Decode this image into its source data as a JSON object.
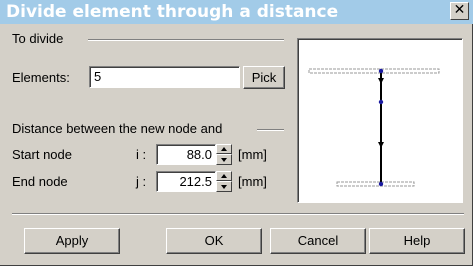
{
  "window": {
    "title": "Divide element through a distance",
    "close_glyph": "✕"
  },
  "divide_group": {
    "heading": "To divide",
    "elements_label": "Elements:",
    "elements_value": "5",
    "pick_label": "Pick"
  },
  "distance_group": {
    "heading": "Distance between the new node and",
    "start": {
      "label": "Start node",
      "index": "i :",
      "value": "88.0",
      "unit": "[mm]"
    },
    "end": {
      "label": "End node",
      "index": "j :",
      "value": "212.5",
      "unit": "[mm]"
    }
  },
  "buttons": {
    "apply": "Apply",
    "ok": "OK",
    "cancel": "Cancel",
    "help": "Help"
  },
  "colors": {
    "titlebar": "#a2cbe8",
    "dialog_bg": "#d4d0c8",
    "node_blue": "#1a1aa0",
    "beam_gray": "#9a9a9a"
  },
  "icons": [
    "close-icon",
    "spin-up-icon",
    "spin-down-icon",
    "beam-preview-diagram"
  ]
}
